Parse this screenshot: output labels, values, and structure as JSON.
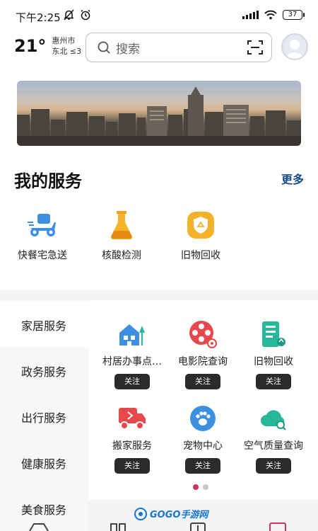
{
  "status_bar": {
    "time": "下午2:25",
    "battery": "37"
  },
  "weather": {
    "temperature": "21°",
    "city": "惠州市",
    "wind": "东北 ≤3"
  },
  "search": {
    "placeholder": "搜索"
  },
  "my_services": {
    "title": "我的服务",
    "more_label": "更多",
    "items": [
      {
        "label": "快餐宅急送",
        "icon": "scooter-icon"
      },
      {
        "label": "核酸检测",
        "icon": "flask-icon"
      },
      {
        "label": "旧物回收",
        "icon": "recycle-shield-icon"
      }
    ]
  },
  "categories": [
    "家居服务",
    "政务服务",
    "出行服务",
    "健康服务",
    "美食服务"
  ],
  "active_category": "家居服务",
  "grid": {
    "follow_label": "关注",
    "items": [
      {
        "label": "村居办事点…",
        "icon": "village-house-icon",
        "color": "#3d8fe0"
      },
      {
        "label": "电影院查询",
        "icon": "film-reel-icon",
        "color": "#e8474c"
      },
      {
        "label": "旧物回收",
        "icon": "recycle-building-icon",
        "color": "#27b79a"
      },
      {
        "label": "搬家服务",
        "icon": "moving-truck-icon",
        "color": "#e8474c"
      },
      {
        "label": "宠物中心",
        "icon": "paw-icon",
        "color": "#3d8fe0"
      },
      {
        "label": "空气质量查询",
        "icon": "cloud-search-icon",
        "color": "#27b79a"
      }
    ]
  },
  "pagination": {
    "pages": 2,
    "current": 1
  },
  "watermark": "GOGO手游网",
  "colors": {
    "accent_blue": "#1b4a8a",
    "follow_button": "#2b2b2b",
    "active_dot": "#c8365a"
  }
}
